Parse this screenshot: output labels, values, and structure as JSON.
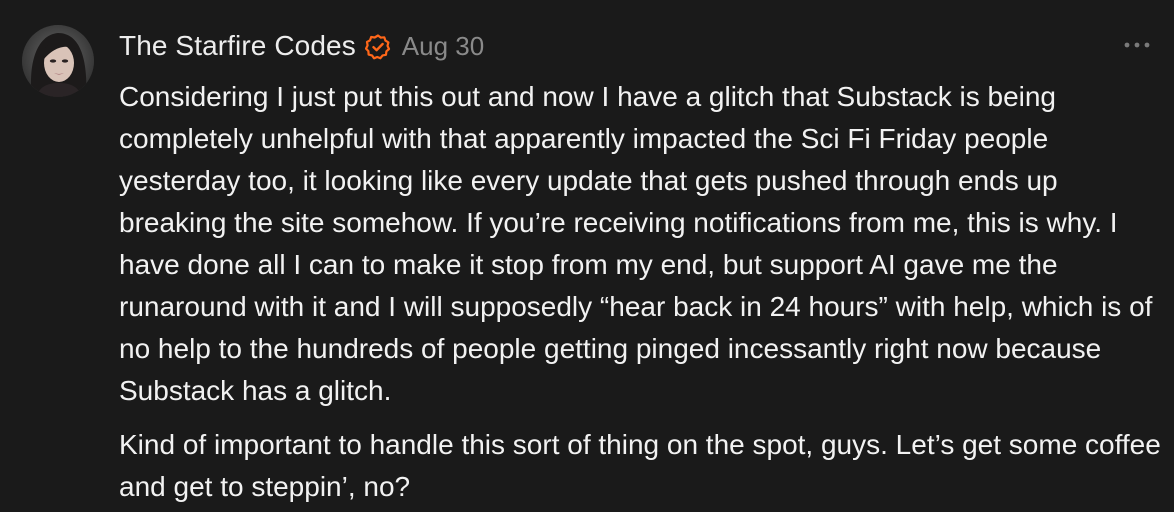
{
  "post": {
    "author": "The Starfire Codes",
    "date": "Aug 30",
    "verified_badge_color": "#ff6719",
    "verified_icon": "verified-check-icon",
    "more_icon": "more-dots-icon",
    "paragraphs": [
      "Considering I just put this out and now I have a glitch that Substack is being completely unhelpful with that apparently impacted the Sci Fi Friday people yesterday too, it looking like every update that gets pushed through ends up breaking the site somehow. If you’re receiving notifications from me, this is why. I have done all I can to make it stop from my end, but support AI gave me the runaround with it and I will supposedly “hear back in 24 hours” with help, which is of no help to the hundreds of people getting pinged incessantly right now because Substack has a glitch.",
      "Kind of important to handle this sort of thing on the spot, guys. Let’s get some coffee and get to steppin’, no?"
    ]
  },
  "colors": {
    "background": "#1a1a1a",
    "text": "#f2f2f2",
    "muted": "#8a8a8a",
    "accent": "#ff6719"
  }
}
